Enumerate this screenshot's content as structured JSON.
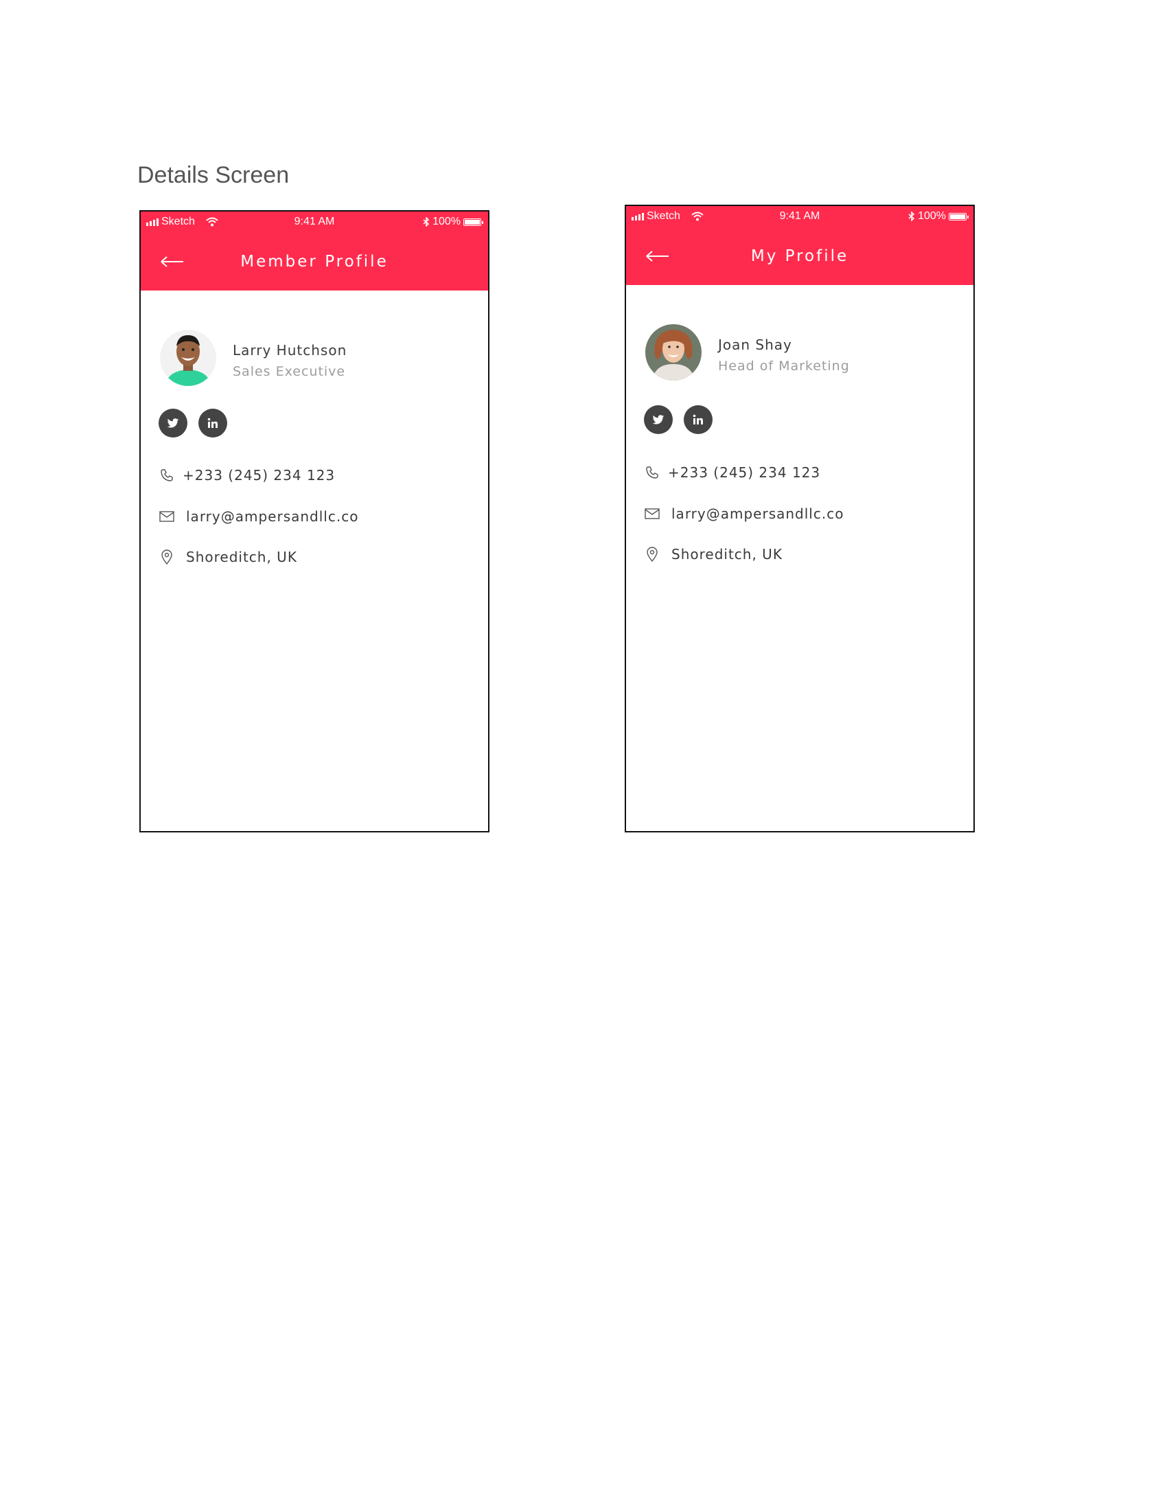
{
  "page_heading": "Details Screen",
  "screens": [
    {
      "status": {
        "carrier": "Sketch",
        "time": "9:41 AM",
        "battery": "100%"
      },
      "title": "Member Profile",
      "name": "Larry Hutchson",
      "role": "Sales Executive",
      "phone": "+233 (245) 234  123",
      "email": "larry@ampersandllc.co",
      "location": "Shoreditch, UK"
    },
    {
      "status": {
        "carrier": "Sketch",
        "time": "9:41 AM",
        "battery": "100%"
      },
      "title": "My Profile",
      "name": "Joan Shay",
      "role": "Head of Marketing",
      "phone": "+233 (245) 234  123",
      "email": "larry@ampersandllc.co",
      "location": "Shoreditch, UK"
    }
  ],
  "colors": {
    "accent": "#ff2b4e",
    "social_bg": "#444444",
    "text": "#3c3c3c",
    "muted": "#9c9c9c"
  },
  "icons": [
    "back-arrow-icon",
    "twitter-icon",
    "linkedin-icon",
    "phone-icon",
    "mail-icon",
    "location-pin-icon",
    "signal-icon",
    "wifi-icon",
    "bluetooth-icon",
    "battery-icon"
  ]
}
